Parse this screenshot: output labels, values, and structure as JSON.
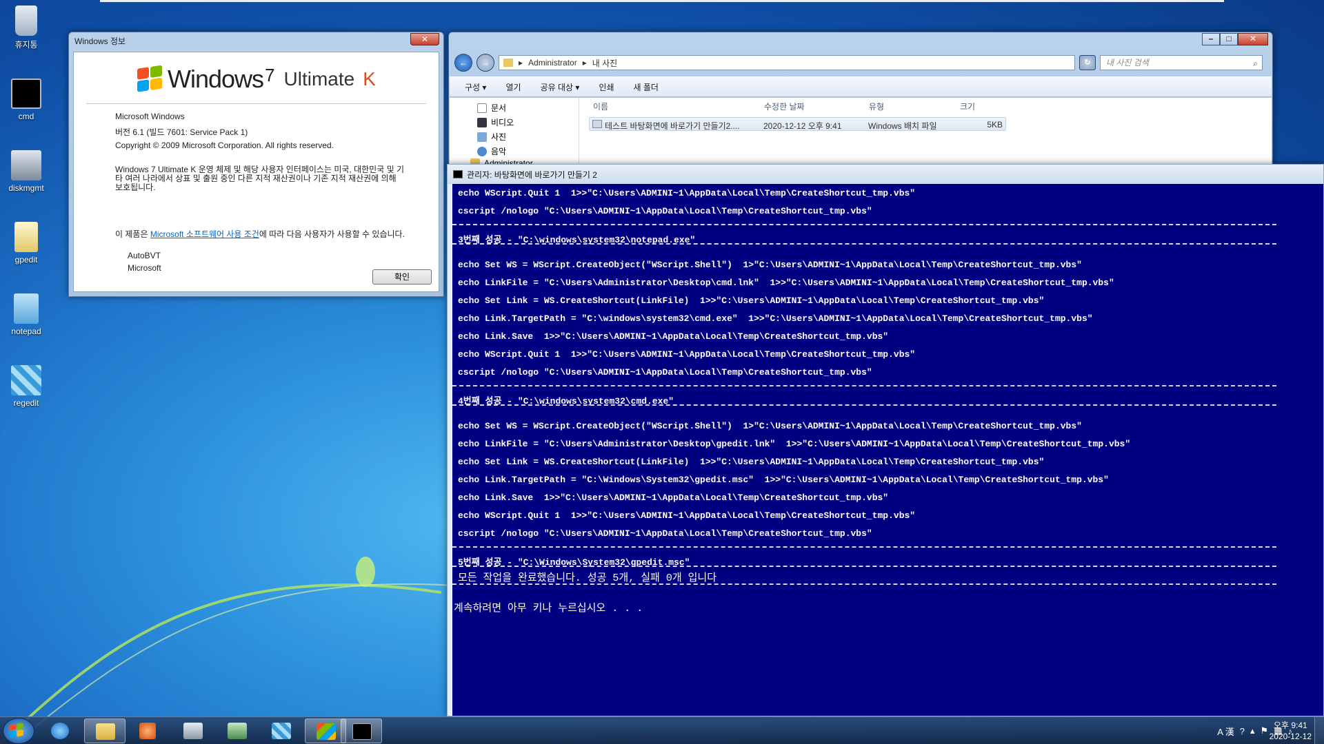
{
  "desktop": {
    "icons": [
      {
        "label": "휴지통",
        "icon": "recycle-bin-icon"
      },
      {
        "label": "cmd",
        "icon": "cmd-icon"
      },
      {
        "label": "diskmgmt",
        "icon": "diskmgmt-icon"
      },
      {
        "label": "gpedit",
        "icon": "gpedit-icon"
      },
      {
        "label": "notepad",
        "icon": "notepad-icon"
      },
      {
        "label": "regedit",
        "icon": "regedit-icon"
      }
    ]
  },
  "about": {
    "title": "Windows 정보",
    "close": "✕",
    "logo_windows": "Windows",
    "logo_7": "7",
    "logo_ultimate": "Ultimate",
    "logo_k": "K",
    "product": "Microsoft Windows",
    "version": "버전 6.1 (빌드 7601: Service Pack 1)",
    "copyright": "Copyright © 2009 Microsoft Corporation. All rights reserved.",
    "legal": "Windows 7 Ultimate K 운영 체제 및 해당 사용자 인터페이스는 미국, 대한민국 및 기타 여러 나라에서 상표 및 출원 중인 다른 지적 재산권이나 기존 지적 재산권에 의해 보호됩니다.",
    "license_prefix": "이 제품은 ",
    "license_link": "Microsoft 소프트웨어 사용 조건",
    "license_suffix": "에 따라 다음 사용자가 사용할 수 있습니다.",
    "user1": "AutoBVT",
    "user2": "Microsoft",
    "ok": "확인"
  },
  "explorer": {
    "breadcrumb1": "Administrator",
    "breadcrumb2": "내 사진",
    "search_placeholder": "내 사진 검색",
    "toolbar": [
      "구성 ▾",
      "열기",
      "공유 대상 ▾",
      "인쇄",
      "새 폴더"
    ],
    "nav": [
      "문서",
      "비디오",
      "사진",
      "음악",
      "Administrator"
    ],
    "columns": {
      "name": "이름",
      "date": "수정한 날짜",
      "type": "유형",
      "size": "크기"
    },
    "file": {
      "name": "테스트 바탕화면에 바로가기 만들기2....",
      "date": "2020-12-12 오후 9:41",
      "type": "Windows 배치 파일",
      "size": "5KB"
    }
  },
  "console": {
    "title": "관리자:  바탕화면에 바로가기 만들기 2",
    "lines": [
      "echo WScript.Quit 1  1>>\"C:\\Users\\ADMINI~1\\AppData\\Local\\Temp\\CreateShortcut_tmp.vbs\"",
      "cscript /nologo \"C:\\Users\\ADMINI~1\\AppData\\Local\\Temp\\CreateShortcut_tmp.vbs\"",
      "3번째 성공 - \"C:\\windows\\system32\\notepad.exe\"",
      "echo Set WS = WScript.CreateObject(\"WScript.Shell\")  1>\"C:\\Users\\ADMINI~1\\AppData\\Local\\Temp\\CreateShortcut_tmp.vbs\"",
      "echo LinkFile = \"C:\\Users\\Administrator\\Desktop\\cmd.lnk\"  1>>\"C:\\Users\\ADMINI~1\\AppData\\Local\\Temp\\CreateShortcut_tmp.vbs\"",
      "echo Set Link = WS.CreateShortcut(LinkFile)  1>>\"C:\\Users\\ADMINI~1\\AppData\\Local\\Temp\\CreateShortcut_tmp.vbs\"",
      "echo Link.TargetPath = \"C:\\windows\\system32\\cmd.exe\"  1>>\"C:\\Users\\ADMINI~1\\AppData\\Local\\Temp\\CreateShortcut_tmp.vbs\"",
      "echo Link.Save  1>>\"C:\\Users\\ADMINI~1\\AppData\\Local\\Temp\\CreateShortcut_tmp.vbs\"",
      "echo WScript.Quit 1  1>>\"C:\\Users\\ADMINI~1\\AppData\\Local\\Temp\\CreateShortcut_tmp.vbs\"",
      "cscript /nologo \"C:\\Users\\ADMINI~1\\AppData\\Local\\Temp\\CreateShortcut_tmp.vbs\"",
      "4번째 성공 - \"C:\\windows\\system32\\cmd.exe\"",
      "echo Set WS = WScript.CreateObject(\"WScript.Shell\")  1>\"C:\\Users\\ADMINI~1\\AppData\\Local\\Temp\\CreateShortcut_tmp.vbs\"",
      "echo LinkFile = \"C:\\Users\\Administrator\\Desktop\\gpedit.lnk\"  1>>\"C:\\Users\\ADMINI~1\\AppData\\Local\\Temp\\CreateShortcut_tmp.vbs\"",
      "echo Set Link = WS.CreateShortcut(LinkFile)  1>>\"C:\\Users\\ADMINI~1\\AppData\\Local\\Temp\\CreateShortcut_tmp.vbs\"",
      "echo Link.TargetPath = \"C:\\Windows\\System32\\gpedit.msc\"  1>>\"C:\\Users\\ADMINI~1\\AppData\\Local\\Temp\\CreateShortcut_tmp.vbs\"",
      "echo Link.Save  1>>\"C:\\Users\\ADMINI~1\\AppData\\Local\\Temp\\CreateShortcut_tmp.vbs\"",
      "echo WScript.Quit 1  1>>\"C:\\Users\\ADMINI~1\\AppData\\Local\\Temp\\CreateShortcut_tmp.vbs\"",
      "cscript /nologo \"C:\\Users\\ADMINI~1\\AppData\\Local\\Temp\\CreateShortcut_tmp.vbs\"",
      "5번째 성공 - \"C:\\Windows\\System32\\gpedit.msc\"",
      "모든 작업을 완료했습니다. 성공 5개, 실패 0개 입니다",
      "계속하려면 아무 키나 누르십시오 . . ."
    ]
  },
  "taskbar": {
    "apps": [
      "internet-explorer-icon",
      "explorer-folder-icon",
      "media-player-icon",
      "diskmgmt-icon",
      "gpedit-icon",
      "regedit-icon",
      "windows-about-icon",
      "cmd-icon"
    ],
    "ime": "A 漢",
    "time": "오후 9:41",
    "date": "2020-12-12"
  }
}
